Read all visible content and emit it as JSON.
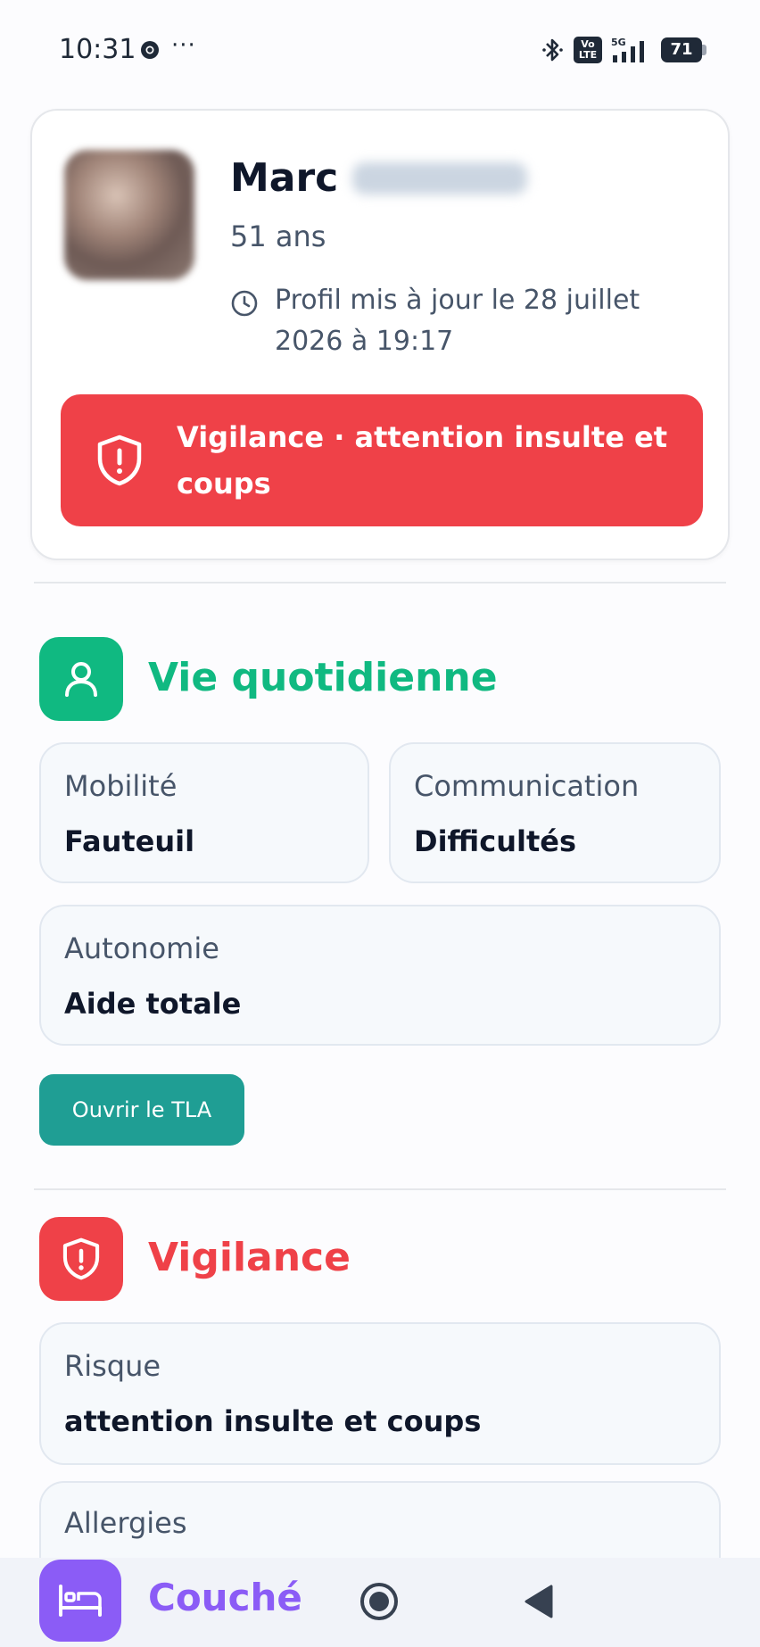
{
  "status_bar": {
    "time": "10:31",
    "dots": "···",
    "network": "5G",
    "volte": "Vo LTE",
    "battery": "71"
  },
  "profile": {
    "first_name": "Marc",
    "age": "51 ans",
    "updated": "Profil mis à jour le 28 juillet 2026 à 19:17",
    "alert": "Vigilance · attention insulte et coups"
  },
  "daily_life": {
    "title": "Vie quotidienne",
    "accent_color": "#10b981",
    "tiles": [
      {
        "label": "Mobilité",
        "value": "Fauteuil"
      },
      {
        "label": "Communication",
        "value": "Difficultés"
      },
      {
        "label": "Autonomie",
        "value": "Aide totale"
      }
    ],
    "button_label": "Ouvrir le TLA"
  },
  "vigilance": {
    "title": "Vigilance",
    "accent_color": "#ef4148",
    "tiles": [
      {
        "label": "Risque",
        "value": "attention insulte et coups"
      },
      {
        "label": "Allergies",
        "value": ""
      }
    ]
  },
  "bottom_bar": {
    "status_label": "Couché",
    "accent_color": "#8b5cf6",
    "icons": [
      "bed-icon",
      "home-nav-icon",
      "back-nav-icon"
    ]
  }
}
